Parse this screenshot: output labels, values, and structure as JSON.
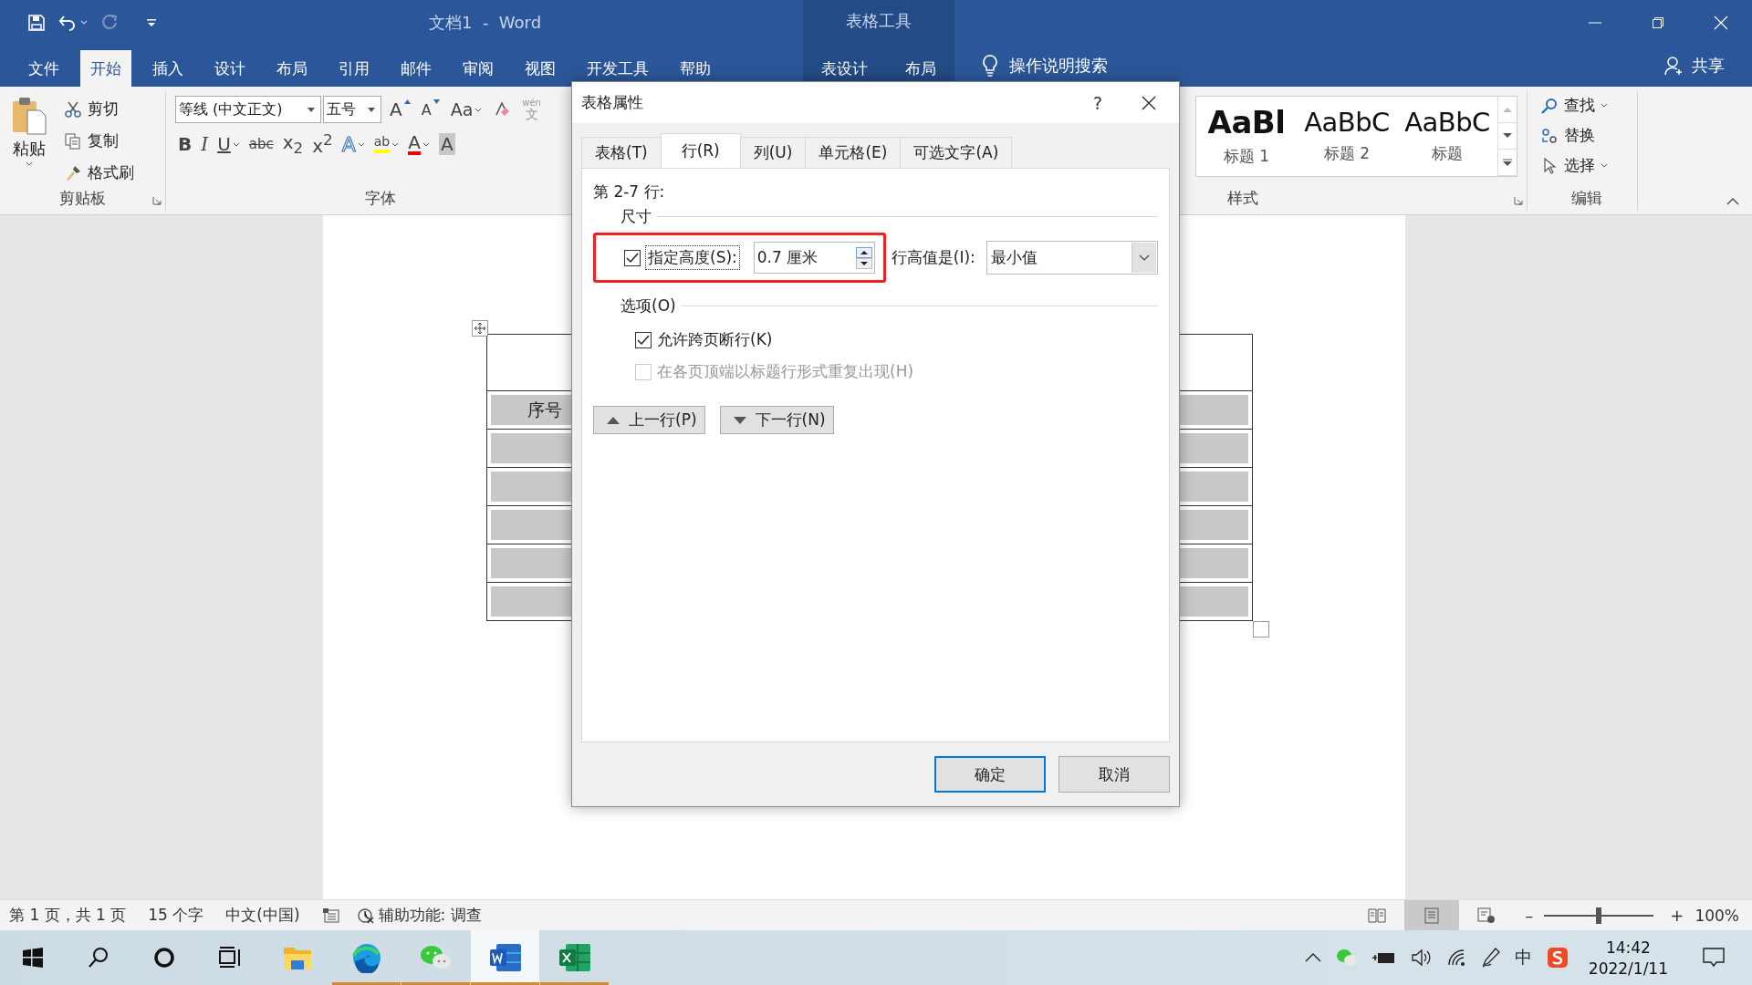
{
  "window": {
    "title": "文档1  -  Word",
    "context_title": "表格工具"
  },
  "ribbon_tabs": [
    {
      "label": "文件",
      "selected": false
    },
    {
      "label": "开始",
      "selected": true
    },
    {
      "label": "插入",
      "selected": false
    },
    {
      "label": "设计",
      "selected": false
    },
    {
      "label": "布局",
      "selected": false
    },
    {
      "label": "引用",
      "selected": false
    },
    {
      "label": "邮件",
      "selected": false
    },
    {
      "label": "审阅",
      "selected": false
    },
    {
      "label": "视图",
      "selected": false
    },
    {
      "label": "开发工具",
      "selected": false
    },
    {
      "label": "帮助",
      "selected": false
    }
  ],
  "context_tabs": [
    {
      "label": "表设计",
      "selected": false
    },
    {
      "label": "布局",
      "selected": false
    }
  ],
  "tell_me": "操作说明搜索",
  "share": "共享",
  "clipboard": {
    "paste": "粘贴",
    "items": [
      {
        "kind": "cut",
        "label": "剪切"
      },
      {
        "kind": "copy",
        "label": "复制"
      },
      {
        "kind": "painter",
        "label": "格式刷"
      }
    ],
    "label": "剪贴板"
  },
  "font": {
    "name": "等线 (中文正文)",
    "size": "五号",
    "label": "字体",
    "row1": [
      {
        "kind": "grow",
        "label": "A"
      },
      {
        "kind": "shrink",
        "label": "A"
      },
      {
        "kind": "case",
        "label": "Aa"
      },
      {
        "kind": "clear"
      },
      {
        "kind": "phonetic",
        "label": "文",
        "ruby": "wén"
      }
    ],
    "row2": [
      {
        "kind": "bold",
        "label": "B"
      },
      {
        "kind": "italic",
        "label": "I"
      },
      {
        "kind": "underline",
        "label": "U"
      },
      {
        "kind": "strike",
        "label": "abc"
      },
      {
        "kind": "plain",
        "label": "x$_{2}$"
      },
      {
        "kind": "plain",
        "label": "x$^{2}$"
      },
      {
        "kind": "effects",
        "label": "A"
      },
      {
        "kind": "highlight",
        "label": "ab"
      },
      {
        "kind": "color",
        "label": "A"
      },
      {
        "kind": "shade",
        "label": "A"
      }
    ]
  },
  "styles": {
    "items": [
      {
        "sample": "AaBl",
        "name": "标题 1",
        "kind": "heading1"
      },
      {
        "sample": "AaBbC",
        "name": "标题 2",
        "kind": "heading2"
      },
      {
        "sample": "AaBbC",
        "name": "标题",
        "kind": "title"
      }
    ],
    "label": "样式"
  },
  "editing": {
    "items": [
      {
        "kind": "find",
        "label": "查找"
      },
      {
        "kind": "replace",
        "label": "替换"
      },
      {
        "kind": "select",
        "label": "选择"
      }
    ],
    "label": "编辑"
  },
  "document": {
    "header_cell": "序号"
  },
  "dialog": {
    "title": "表格属性",
    "help": "?",
    "tabs": [
      {
        "label": "表格(T)",
        "selected": false
      },
      {
        "label": "行(R)",
        "selected": true
      },
      {
        "label": "列(U)",
        "selected": false
      },
      {
        "label": "单元格(E)",
        "selected": false
      },
      {
        "label": "可选文字(A)",
        "selected": false
      }
    ],
    "heading": "第 2-7 行:",
    "size_group": "尺寸",
    "height": {
      "label": "指定高度(S):",
      "checked": true,
      "value": "0.7 厘米"
    },
    "rule": {
      "label": "行高值是(I):",
      "value": "最小值"
    },
    "annotation_frame": true,
    "options_group": "选项(O)",
    "options": [
      {
        "label": "允许跨页断行(K)",
        "checked": true,
        "disabled": false
      },
      {
        "label": "在各页顶端以标题行形式重复出现(H)",
        "checked": false,
        "disabled": true
      }
    ],
    "nav": [
      {
        "kind": "up",
        "label": "上一行(P)"
      },
      {
        "kind": "down",
        "label": "下一行(N)"
      }
    ],
    "buttons": [
      {
        "label": "确定",
        "default": true
      },
      {
        "label": "取消",
        "default": false
      }
    ]
  },
  "status_bar": {
    "items": [
      "第 1 页，共 1 页",
      "15 个字",
      "中文(中国)"
    ],
    "accessibility": "辅助功能: 调查",
    "views": [
      {
        "kind": "read",
        "selected": false
      },
      {
        "kind": "print",
        "selected": true
      },
      {
        "kind": "web",
        "selected": false
      }
    ],
    "zoom_out": "–",
    "zoom_in": "+",
    "zoom": {
      "level": 0.5
    },
    "zoom_text": "100%"
  },
  "taskbar": {
    "apps": [
      {
        "kind": "explorer",
        "running": false,
        "selected": false
      },
      {
        "kind": "edge",
        "running": true,
        "selected": false
      },
      {
        "kind": "wechat",
        "running": true,
        "selected": false
      },
      {
        "kind": "word",
        "running": true,
        "selected": true
      },
      {
        "kind": "excel",
        "running": true,
        "selected": false
      }
    ],
    "ime": "中",
    "time": "14:42",
    "date": "2022/1/11"
  }
}
